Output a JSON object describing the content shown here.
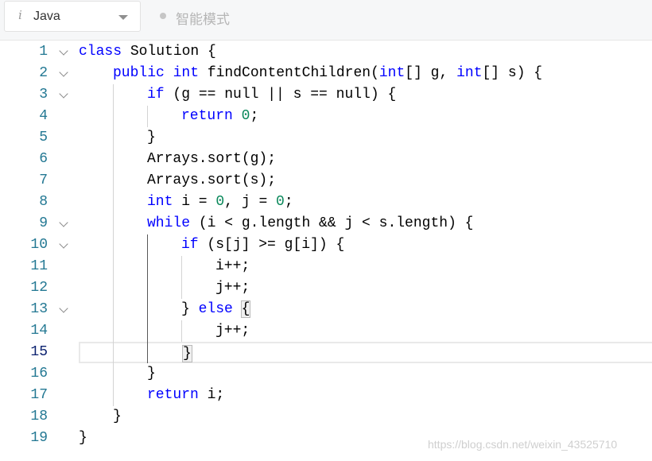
{
  "toolbar": {
    "language": "Java",
    "language_info_icon": "i",
    "mode_label": "智能模式",
    "icons": {
      "info": "info-icon",
      "caret": "chevron-down-icon",
      "mode": "dot-icon"
    }
  },
  "editor": {
    "active_line": 15,
    "lines": [
      {
        "n": "1",
        "fold": true,
        "indent": 0,
        "tokens": [
          [
            "k",
            "class"
          ],
          [
            "p",
            " Solution {"
          ]
        ]
      },
      {
        "n": "2",
        "fold": true,
        "indent": 1,
        "tokens": [
          [
            "k",
            "public"
          ],
          [
            "p",
            " "
          ],
          [
            "k",
            "int"
          ],
          [
            "p",
            " findContentChildren("
          ],
          [
            "k",
            "int"
          ],
          [
            "p",
            "[] g, "
          ],
          [
            "k",
            "int"
          ],
          [
            "p",
            "[] s) {"
          ]
        ]
      },
      {
        "n": "3",
        "fold": true,
        "indent": 2,
        "tokens": [
          [
            "k",
            "if"
          ],
          [
            "p",
            " (g == null || s == null) {"
          ]
        ]
      },
      {
        "n": "4",
        "fold": false,
        "indent": 3,
        "tokens": [
          [
            "k",
            "return"
          ],
          [
            "p",
            " "
          ],
          [
            "n",
            "0"
          ],
          [
            "p",
            ";"
          ]
        ]
      },
      {
        "n": "5",
        "fold": false,
        "indent": 2,
        "tokens": [
          [
            "p",
            "}"
          ]
        ]
      },
      {
        "n": "6",
        "fold": false,
        "indent": 2,
        "tokens": [
          [
            "p",
            "Arrays.sort(g);"
          ]
        ]
      },
      {
        "n": "7",
        "fold": false,
        "indent": 2,
        "tokens": [
          [
            "p",
            "Arrays.sort(s);"
          ]
        ]
      },
      {
        "n": "8",
        "fold": false,
        "indent": 2,
        "tokens": [
          [
            "k",
            "int"
          ],
          [
            "p",
            " i = "
          ],
          [
            "n",
            "0"
          ],
          [
            "p",
            ", j = "
          ],
          [
            "n",
            "0"
          ],
          [
            "p",
            ";"
          ]
        ]
      },
      {
        "n": "9",
        "fold": true,
        "indent": 2,
        "tokens": [
          [
            "k",
            "while"
          ],
          [
            "p",
            " (i < g.length && j < s.length) {"
          ]
        ]
      },
      {
        "n": "10",
        "fold": true,
        "indent": 3,
        "tokens": [
          [
            "k",
            "if"
          ],
          [
            "p",
            " (s[j] >= g[i]) {"
          ]
        ]
      },
      {
        "n": "11",
        "fold": false,
        "indent": 4,
        "tokens": [
          [
            "p",
            "i++;"
          ]
        ]
      },
      {
        "n": "12",
        "fold": false,
        "indent": 4,
        "tokens": [
          [
            "p",
            "j++;"
          ]
        ]
      },
      {
        "n": "13",
        "fold": true,
        "indent": 3,
        "tokens": [
          [
            "p",
            "} "
          ],
          [
            "k",
            "else"
          ],
          [
            "p",
            " "
          ],
          [
            "b",
            "{"
          ]
        ]
      },
      {
        "n": "14",
        "fold": false,
        "indent": 4,
        "tokens": [
          [
            "p",
            "j++;"
          ]
        ]
      },
      {
        "n": "15",
        "fold": false,
        "indent": 3,
        "tokens": [
          [
            "b",
            "}"
          ]
        ]
      },
      {
        "n": "16",
        "fold": false,
        "indent": 2,
        "tokens": [
          [
            "p",
            "}"
          ]
        ]
      },
      {
        "n": "17",
        "fold": false,
        "indent": 2,
        "tokens": [
          [
            "k",
            "return"
          ],
          [
            "p",
            " i;"
          ]
        ]
      },
      {
        "n": "18",
        "fold": false,
        "indent": 1,
        "tokens": [
          [
            "p",
            "}"
          ]
        ]
      },
      {
        "n": "19",
        "fold": false,
        "indent": 0,
        "tokens": [
          [
            "p",
            "}"
          ]
        ]
      }
    ]
  },
  "watermark": "https://blog.csdn.net/weixin_43525710"
}
